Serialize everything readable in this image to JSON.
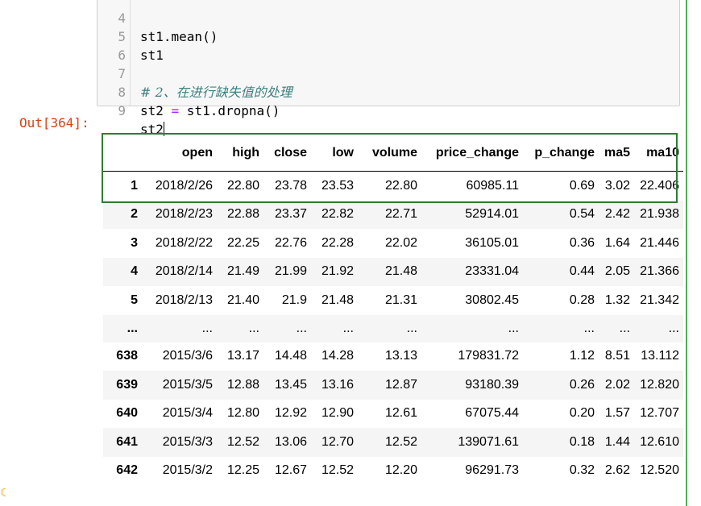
{
  "editor": {
    "lines": [
      {
        "num": "4",
        "code": "st1.mean()"
      },
      {
        "num": "5",
        "code": "st1"
      },
      {
        "num": "6",
        "code": ""
      },
      {
        "num": "7",
        "code": "# 2、在进行缺失值的处理"
      },
      {
        "num": "8",
        "code_a": "st2 ",
        "code_op": "=",
        "code_b": " st1.dropna()"
      },
      {
        "num": "9",
        "code": "st2"
      }
    ]
  },
  "output": {
    "prompt": "Out[364]:",
    "columns": [
      "",
      "open",
      "high",
      "close",
      "low",
      "volume",
      "price_change",
      "p_change",
      "ma5",
      "ma10"
    ],
    "rows": [
      [
        "1",
        "2018/2/26",
        "22.80",
        "23.78",
        "23.53",
        "22.80",
        "60985.11",
        "0.69",
        "3.02",
        "22.406"
      ],
      [
        "2",
        "2018/2/23",
        "22.88",
        "23.37",
        "22.82",
        "22.71",
        "52914.01",
        "0.54",
        "2.42",
        "21.938"
      ],
      [
        "3",
        "2018/2/22",
        "22.25",
        "22.76",
        "22.28",
        "22.02",
        "36105.01",
        "0.36",
        "1.64",
        "21.446"
      ],
      [
        "4",
        "2018/2/14",
        "21.49",
        "21.99",
        "21.92",
        "21.48",
        "23331.04",
        "0.44",
        "2.05",
        "21.366"
      ],
      [
        "5",
        "2018/2/13",
        "21.40",
        "21.9",
        "21.48",
        "21.31",
        "30802.45",
        "0.28",
        "1.32",
        "21.342"
      ],
      [
        "...",
        "...",
        "...",
        "...",
        "...",
        "...",
        "...",
        "...",
        "...",
        "..."
      ],
      [
        "638",
        "2015/3/6",
        "13.17",
        "14.48",
        "14.28",
        "13.13",
        "179831.72",
        "1.12",
        "8.51",
        "13.112"
      ],
      [
        "639",
        "2015/3/5",
        "12.88",
        "13.45",
        "13.16",
        "12.87",
        "93180.39",
        "0.26",
        "2.02",
        "12.820"
      ],
      [
        "640",
        "2015/3/4",
        "12.80",
        "12.92",
        "12.90",
        "12.61",
        "67075.44",
        "0.20",
        "1.57",
        "12.707"
      ],
      [
        "641",
        "2015/3/3",
        "12.52",
        "13.06",
        "12.70",
        "12.52",
        "139071.61",
        "0.18",
        "1.44",
        "12.610"
      ],
      [
        "642",
        "2015/3/2",
        "12.25",
        "12.67",
        "12.52",
        "12.20",
        "96291.73",
        "0.32",
        "2.62",
        "12.520"
      ]
    ]
  },
  "colors": {
    "prompt": "#d84315",
    "comment": "#408080",
    "operator": "#aa22ff",
    "highlight": "#2e7d32",
    "cell_border": "#4caf50"
  },
  "icons": {
    "status": "moon-icon"
  }
}
